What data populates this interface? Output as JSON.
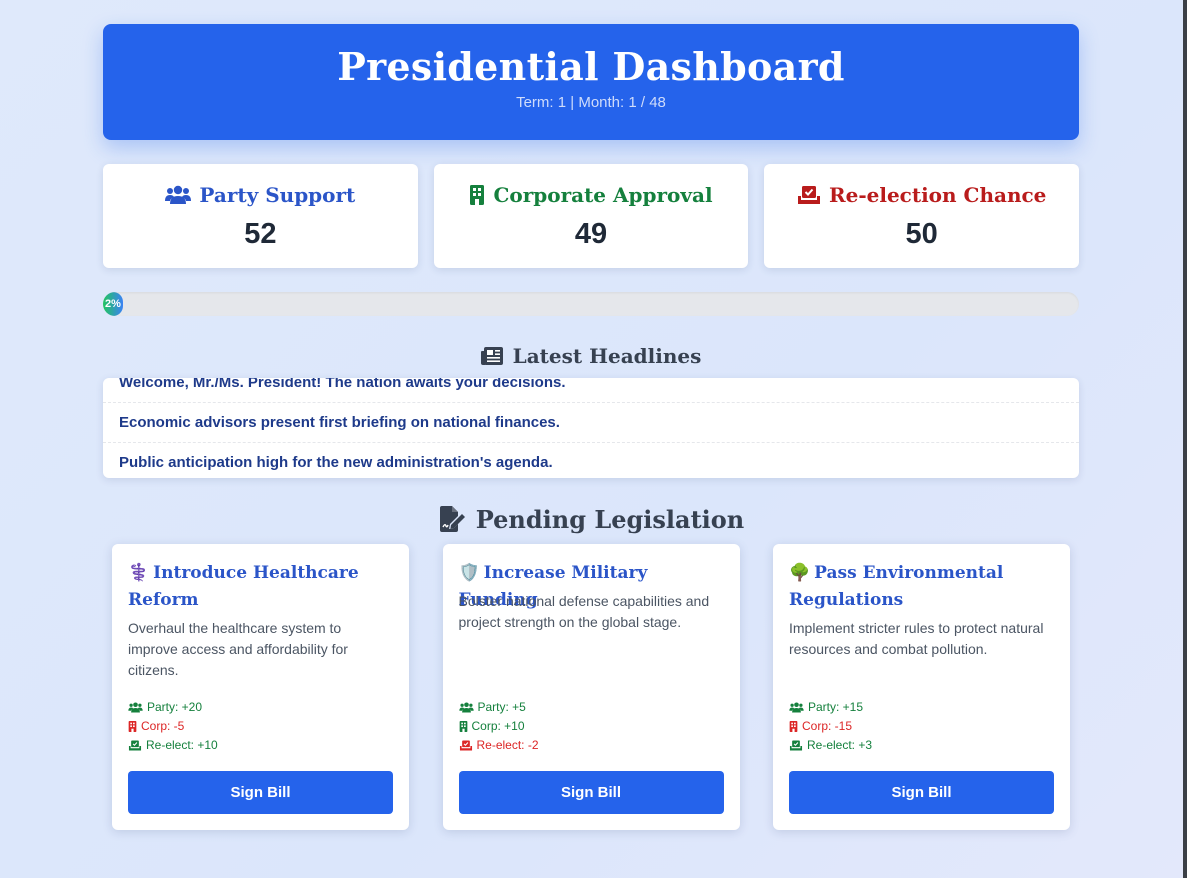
{
  "header": {
    "title": "Presidential Dashboard",
    "subtitle": "Term: 1 | Month: 1 / 48"
  },
  "stats": [
    {
      "label": "Party Support",
      "value": "52",
      "icon": "users-icon",
      "color": "#2b55c8"
    },
    {
      "label": "Corporate Approval",
      "value": "49",
      "icon": "building-icon",
      "color": "#15803d"
    },
    {
      "label": "Re-election Chance",
      "value": "50",
      "icon": "vote-box-icon",
      "color": "#b91c1c"
    }
  ],
  "progress": {
    "label": "2%",
    "percent": 2
  },
  "headlines": {
    "title": "Latest Headlines",
    "icon": "newspaper-icon",
    "items": [
      "Welcome, Mr./Ms. President! The nation awaits your decisions.",
      "Economic advisors present first briefing on national finances.",
      "Public anticipation high for the new administration's agenda."
    ]
  },
  "legislation": {
    "title": "Pending Legislation",
    "icon": "signature-icon",
    "bills": [
      {
        "emoji": "⚕️",
        "title": "Introduce Healthcare Reform",
        "description": "Overhaul the healthcare system to improve access and affordability for citizens.",
        "party": "Party: +20",
        "corp": "Corp: -5",
        "reelect": "Re-elect: +10",
        "button": "Sign Bill"
      },
      {
        "emoji": "🛡️",
        "title": "Increase Military Funding",
        "description": "Bolster national defense capabilities and project strength on the global stage.",
        "party": "Party: +5",
        "corp": "Corp: +10",
        "reelect": "Re-elect: -2",
        "button": "Sign Bill"
      },
      {
        "emoji": "🌳",
        "title": "Pass Environmental Regulations",
        "description": "Implement stricter rules to protect natural resources and combat pollution.",
        "party": "Party: +15",
        "corp": "Corp: -15",
        "reelect": "Re-elect: +3",
        "button": "Sign Bill"
      }
    ]
  }
}
